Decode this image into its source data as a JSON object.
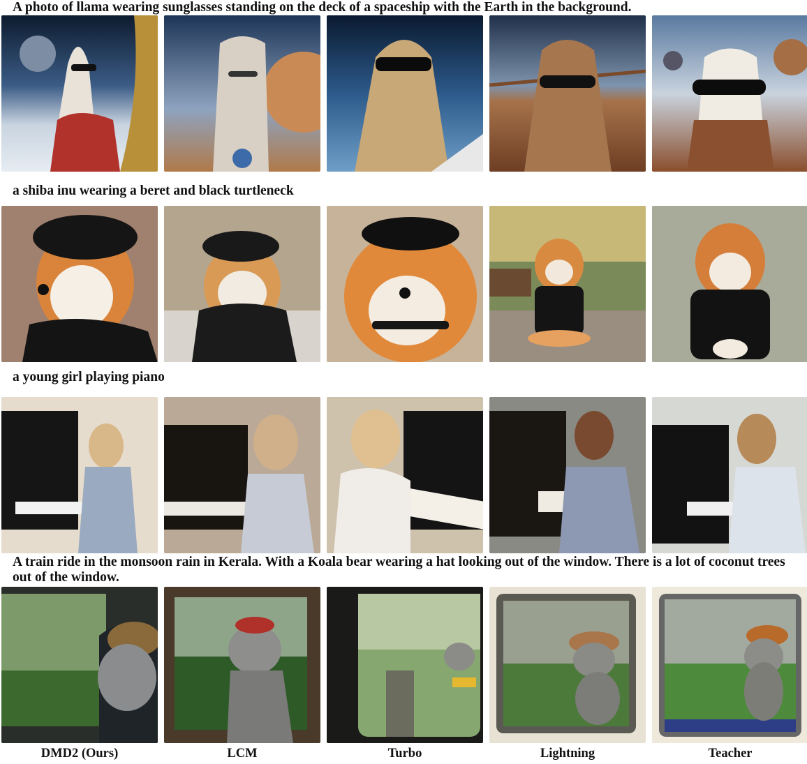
{
  "prompts": [
    "A photo of llama wearing sunglasses standing on the deck of a spaceship with the Earth in the background.",
    "a shiba inu wearing a beret and black turtleneck",
    "a young girl playing piano",
    "A train ride in the monsoon rain in Kerala. With a Koala bear wearing a hat looking out of the window. There is a lot of coconut trees out of the window."
  ],
  "methods": [
    "DMD2 (Ours)",
    "LCM",
    "Turbo",
    "Lightning",
    "Teacher"
  ],
  "image_rows": [
    {
      "subject": "llama",
      "images": [
        "llama-dmd2",
        "llama-lcm",
        "llama-turbo",
        "llama-lightning",
        "llama-teacher"
      ]
    },
    {
      "subject": "shiba",
      "images": [
        "shiba-dmd2",
        "shiba-lcm",
        "shiba-turbo",
        "shiba-lightning",
        "shiba-teacher"
      ]
    },
    {
      "subject": "piano",
      "images": [
        "piano-dmd2",
        "piano-lcm",
        "piano-turbo",
        "piano-lightning",
        "piano-teacher"
      ]
    },
    {
      "subject": "koala",
      "images": [
        "koala-dmd2",
        "koala-lcm",
        "koala-turbo",
        "koala-lightning",
        "koala-teacher"
      ]
    }
  ]
}
